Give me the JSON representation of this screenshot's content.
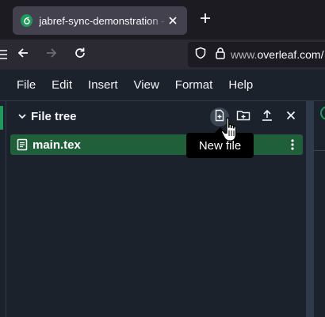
{
  "browser": {
    "tab_title": "jabref-sync-demonstration - Ov",
    "url_host": "www.overleaf.com/",
    "url_prefix_dim": "www.",
    "url_main": "overleaf.com/"
  },
  "menu": {
    "items": [
      "File",
      "Edit",
      "Insert",
      "View",
      "Format",
      "Help"
    ]
  },
  "file_tree": {
    "title": "File tree",
    "files": [
      {
        "name": "main.tex",
        "selected": true
      }
    ]
  },
  "tooltip": {
    "text": "New file"
  },
  "colors": {
    "accent": "#1e9a5a",
    "selected_row": "#1f5f3a",
    "app_bg": "#1b222c"
  },
  "icons": {
    "tab": [
      "overleaf-favicon-icon",
      "close-icon",
      "plus-icon"
    ],
    "nav": [
      "back-arrow-icon",
      "forward-arrow-icon",
      "reload-icon",
      "shield-icon",
      "lock-icon"
    ],
    "file_tree_tools": [
      "new-file-icon",
      "new-folder-icon",
      "upload-icon",
      "close-icon"
    ],
    "file": [
      "file-icon",
      "kebab-menu-icon"
    ]
  }
}
